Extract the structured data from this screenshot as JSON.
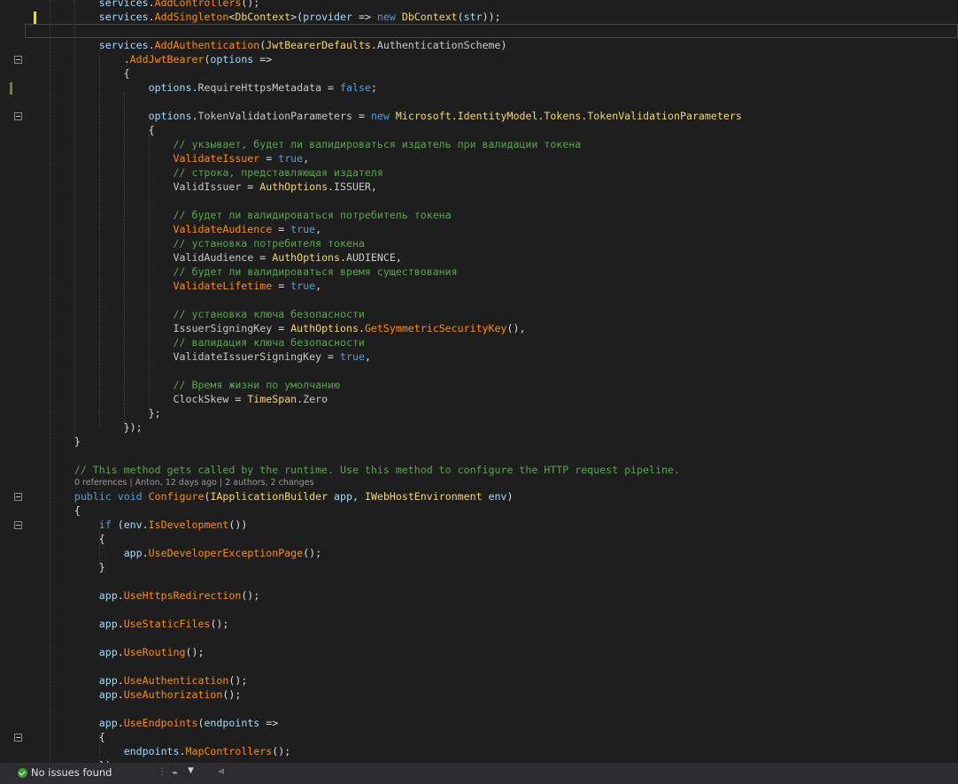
{
  "editor": {
    "lines": [
      [
        [
          "            ",
          "plain"
        ],
        [
          "services",
          "var"
        ],
        [
          ".",
          "plain"
        ],
        [
          "AddControllers",
          "prop"
        ],
        [
          "();",
          "plain"
        ]
      ],
      [
        [
          "            ",
          "plain"
        ],
        [
          "services",
          "var"
        ],
        [
          ".",
          "plain"
        ],
        [
          "AddSingleton",
          "prop"
        ],
        [
          "<",
          "plain"
        ],
        [
          "DbContext",
          "cls"
        ],
        [
          ">(",
          "plain"
        ],
        [
          "provider",
          "var"
        ],
        [
          " => ",
          "plain"
        ],
        [
          "new",
          "kw"
        ],
        [
          " ",
          "plain"
        ],
        [
          "DbContext",
          "cls"
        ],
        [
          "(",
          "plain"
        ],
        [
          "str",
          "var"
        ],
        [
          "));",
          "plain"
        ]
      ],
      [
        [
          "",
          "plain"
        ]
      ],
      [
        [
          "            ",
          "plain"
        ],
        [
          "services",
          "var"
        ],
        [
          ".",
          "plain"
        ],
        [
          "AddAuthentication",
          "prop"
        ],
        [
          "(",
          "plain"
        ],
        [
          "JwtBearerDefaults",
          "cls"
        ],
        [
          ".",
          "plain"
        ],
        [
          "AuthenticationScheme",
          "const"
        ],
        [
          ")",
          "plain"
        ]
      ],
      [
        [
          "                ",
          "plain"
        ],
        [
          ".",
          "plain"
        ],
        [
          "AddJwtBearer",
          "prop"
        ],
        [
          "(",
          "plain"
        ],
        [
          "options",
          "var"
        ],
        [
          " =>",
          "plain"
        ]
      ],
      [
        [
          "                {",
          "plain"
        ]
      ],
      [
        [
          "                    ",
          "plain"
        ],
        [
          "options",
          "var"
        ],
        [
          ".",
          "plain"
        ],
        [
          "RequireHttpsMetadata",
          "const"
        ],
        [
          " = ",
          "plain"
        ],
        [
          "false",
          "kw"
        ],
        [
          ";",
          "plain"
        ]
      ],
      [
        [
          "",
          "plain"
        ]
      ],
      [
        [
          "                    ",
          "plain"
        ],
        [
          "options",
          "var"
        ],
        [
          ".",
          "plain"
        ],
        [
          "TokenValidationParameters",
          "const"
        ],
        [
          " = ",
          "plain"
        ],
        [
          "new",
          "kw"
        ],
        [
          " ",
          "plain"
        ],
        [
          "Microsoft",
          "cls"
        ],
        [
          ".",
          "plain"
        ],
        [
          "IdentityModel",
          "cls"
        ],
        [
          ".",
          "plain"
        ],
        [
          "Tokens",
          "cls"
        ],
        [
          ".",
          "plain"
        ],
        [
          "TokenValidationParameters",
          "cls"
        ]
      ],
      [
        [
          "                    {",
          "plain"
        ]
      ],
      [
        [
          "                        ",
          "plain"
        ],
        [
          "// укзывает, будет ли валидироваться издатель при валидации токена",
          "comment"
        ]
      ],
      [
        [
          "                        ",
          "plain"
        ],
        [
          "ValidateIssuer",
          "prop"
        ],
        [
          " = ",
          "plain"
        ],
        [
          "true",
          "kw"
        ],
        [
          ",",
          "plain"
        ]
      ],
      [
        [
          "                        ",
          "plain"
        ],
        [
          "// строка, представляющая издателя",
          "comment"
        ]
      ],
      [
        [
          "                        ",
          "plain"
        ],
        [
          "ValidIssuer",
          "const"
        ],
        [
          " = ",
          "plain"
        ],
        [
          "AuthOptions",
          "cls"
        ],
        [
          ".",
          "plain"
        ],
        [
          "ISSUER",
          "const"
        ],
        [
          ",",
          "plain"
        ]
      ],
      [
        [
          "",
          "plain"
        ]
      ],
      [
        [
          "                        ",
          "plain"
        ],
        [
          "// будет ли валидироваться потребитель токена",
          "comment"
        ]
      ],
      [
        [
          "                        ",
          "plain"
        ],
        [
          "ValidateAudience",
          "prop"
        ],
        [
          " = ",
          "plain"
        ],
        [
          "true",
          "kw"
        ],
        [
          ",",
          "plain"
        ]
      ],
      [
        [
          "                        ",
          "plain"
        ],
        [
          "// установка потребителя токена",
          "comment"
        ]
      ],
      [
        [
          "                        ",
          "plain"
        ],
        [
          "ValidAudience",
          "const"
        ],
        [
          " = ",
          "plain"
        ],
        [
          "AuthOptions",
          "cls"
        ],
        [
          ".",
          "plain"
        ],
        [
          "AUDIENCE",
          "const"
        ],
        [
          ",",
          "plain"
        ]
      ],
      [
        [
          "                        ",
          "plain"
        ],
        [
          "// будет ли валидироваться время существования",
          "comment"
        ]
      ],
      [
        [
          "                        ",
          "plain"
        ],
        [
          "ValidateLifetime",
          "prop"
        ],
        [
          " = ",
          "plain"
        ],
        [
          "true",
          "kw"
        ],
        [
          ",",
          "plain"
        ]
      ],
      [
        [
          "",
          "plain"
        ]
      ],
      [
        [
          "                        ",
          "plain"
        ],
        [
          "// установка ключа безопасности",
          "comment"
        ]
      ],
      [
        [
          "                        ",
          "plain"
        ],
        [
          "IssuerSigningKey",
          "const"
        ],
        [
          " = ",
          "plain"
        ],
        [
          "AuthOptions",
          "cls"
        ],
        [
          ".",
          "plain"
        ],
        [
          "GetSymmetricSecurityKey",
          "prop"
        ],
        [
          "(),",
          "plain"
        ]
      ],
      [
        [
          "                        ",
          "plain"
        ],
        [
          "// валидация ключа безопасности",
          "comment"
        ]
      ],
      [
        [
          "                        ",
          "plain"
        ],
        [
          "ValidateIssuerSigningKey",
          "const"
        ],
        [
          " = ",
          "plain"
        ],
        [
          "true",
          "kw"
        ],
        [
          ",",
          "plain"
        ]
      ],
      [
        [
          "",
          "plain"
        ]
      ],
      [
        [
          "                        ",
          "plain"
        ],
        [
          "// Время жизни по умолчанию",
          "comment"
        ]
      ],
      [
        [
          "                        ",
          "plain"
        ],
        [
          "ClockSkew",
          "const"
        ],
        [
          " = ",
          "plain"
        ],
        [
          "TimeSpan",
          "cls"
        ],
        [
          ".",
          "plain"
        ],
        [
          "Zero",
          "const"
        ]
      ],
      [
        [
          "                    };",
          "plain"
        ]
      ],
      [
        [
          "                });",
          "plain"
        ]
      ],
      [
        [
          "        }",
          "plain"
        ]
      ],
      [
        [
          "",
          "plain"
        ]
      ],
      [
        [
          "        ",
          "plain"
        ],
        [
          "// This method gets called by the runtime. Use this method to configure the HTTP request pipeline.",
          "comment"
        ]
      ],
      [
        [
          "        ",
          "plain"
        ],
        [
          "public",
          "kw"
        ],
        [
          " ",
          "plain"
        ],
        [
          "void",
          "kw"
        ],
        [
          " ",
          "plain"
        ],
        [
          "Configure",
          "prop"
        ],
        [
          "(",
          "plain"
        ],
        [
          "IApplicationBuilder",
          "cls"
        ],
        [
          " ",
          "plain"
        ],
        [
          "app",
          "var"
        ],
        [
          ", ",
          "plain"
        ],
        [
          "IWebHostEnvironment",
          "cls"
        ],
        [
          " ",
          "plain"
        ],
        [
          "env",
          "var"
        ],
        [
          ")",
          "plain"
        ]
      ],
      [
        [
          "        {",
          "plain"
        ]
      ],
      [
        [
          "            ",
          "plain"
        ],
        [
          "if",
          "kw"
        ],
        [
          " (",
          "plain"
        ],
        [
          "env",
          "var"
        ],
        [
          ".",
          "plain"
        ],
        [
          "IsDevelopment",
          "prop"
        ],
        [
          "())",
          "plain"
        ]
      ],
      [
        [
          "            {",
          "plain"
        ]
      ],
      [
        [
          "                ",
          "plain"
        ],
        [
          "app",
          "var"
        ],
        [
          ".",
          "plain"
        ],
        [
          "UseDeveloperExceptionPage",
          "prop"
        ],
        [
          "();",
          "plain"
        ]
      ],
      [
        [
          "            }",
          "plain"
        ]
      ],
      [
        [
          "",
          "plain"
        ]
      ],
      [
        [
          "            ",
          "plain"
        ],
        [
          "app",
          "var"
        ],
        [
          ".",
          "plain"
        ],
        [
          "UseHttpsRedirection",
          "prop"
        ],
        [
          "();",
          "plain"
        ]
      ],
      [
        [
          "",
          "plain"
        ]
      ],
      [
        [
          "            ",
          "plain"
        ],
        [
          "app",
          "var"
        ],
        [
          ".",
          "plain"
        ],
        [
          "UseStaticFiles",
          "prop"
        ],
        [
          "();",
          "plain"
        ]
      ],
      [
        [
          "",
          "plain"
        ]
      ],
      [
        [
          "            ",
          "plain"
        ],
        [
          "app",
          "var"
        ],
        [
          ".",
          "plain"
        ],
        [
          "UseRouting",
          "prop"
        ],
        [
          "();",
          "plain"
        ]
      ],
      [
        [
          "",
          "plain"
        ]
      ],
      [
        [
          "            ",
          "plain"
        ],
        [
          "app",
          "var"
        ],
        [
          ".",
          "plain"
        ],
        [
          "UseAuthentication",
          "prop"
        ],
        [
          "();",
          "plain"
        ]
      ],
      [
        [
          "            ",
          "plain"
        ],
        [
          "app",
          "var"
        ],
        [
          ".",
          "plain"
        ],
        [
          "UseAuthorization",
          "prop"
        ],
        [
          "();",
          "plain"
        ]
      ],
      [
        [
          "",
          "plain"
        ]
      ],
      [
        [
          "            ",
          "plain"
        ],
        [
          "app",
          "var"
        ],
        [
          ".",
          "plain"
        ],
        [
          "UseEndpoints",
          "prop"
        ],
        [
          "(",
          "plain"
        ],
        [
          "endpoints",
          "var"
        ],
        [
          " =>",
          "plain"
        ]
      ],
      [
        [
          "            {",
          "plain"
        ]
      ],
      [
        [
          "                ",
          "plain"
        ],
        [
          "endpoints",
          "var"
        ],
        [
          ".",
          "plain"
        ],
        [
          "MapControllers",
          "prop"
        ],
        [
          "();",
          "plain"
        ]
      ],
      [
        [
          "            });",
          "plain"
        ]
      ]
    ],
    "codelens": "0 references | Anton, 12 days ago | 2 authors, 2 changes"
  },
  "status": {
    "issues_label": "No issues found",
    "icon_names": [
      "check-circle-icon",
      "brush-icon",
      "chevron-down-icon",
      "scroll-left-icon"
    ]
  },
  "colors": {
    "background": "#1e1e1e",
    "keyword": "#569cd6",
    "comment": "#57a64a",
    "method": "#ff8c00",
    "class": "#f5d767",
    "variable": "#9cdcfe",
    "status_bar": "#2d2d30"
  }
}
